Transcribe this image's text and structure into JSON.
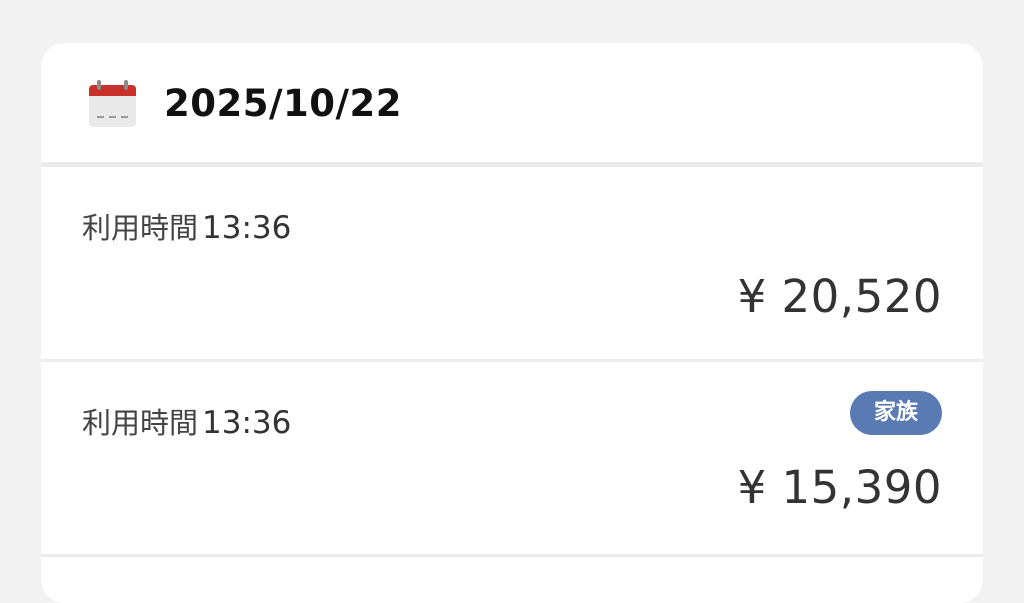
{
  "header": {
    "date": "2025/10/22",
    "icon": "calendar-icon"
  },
  "transactions": [
    {
      "time_label": "利用時間",
      "time_value": "13:36",
      "amount": "¥ 20,520",
      "badge": ""
    },
    {
      "time_label": "利用時間",
      "time_value": "13:36",
      "amount": "¥ 15,390",
      "badge": "家族"
    }
  ],
  "colors": {
    "badge_bg": "#5a7ab3",
    "calendar_red": "#c9302c",
    "background": "#f2f2f2"
  }
}
